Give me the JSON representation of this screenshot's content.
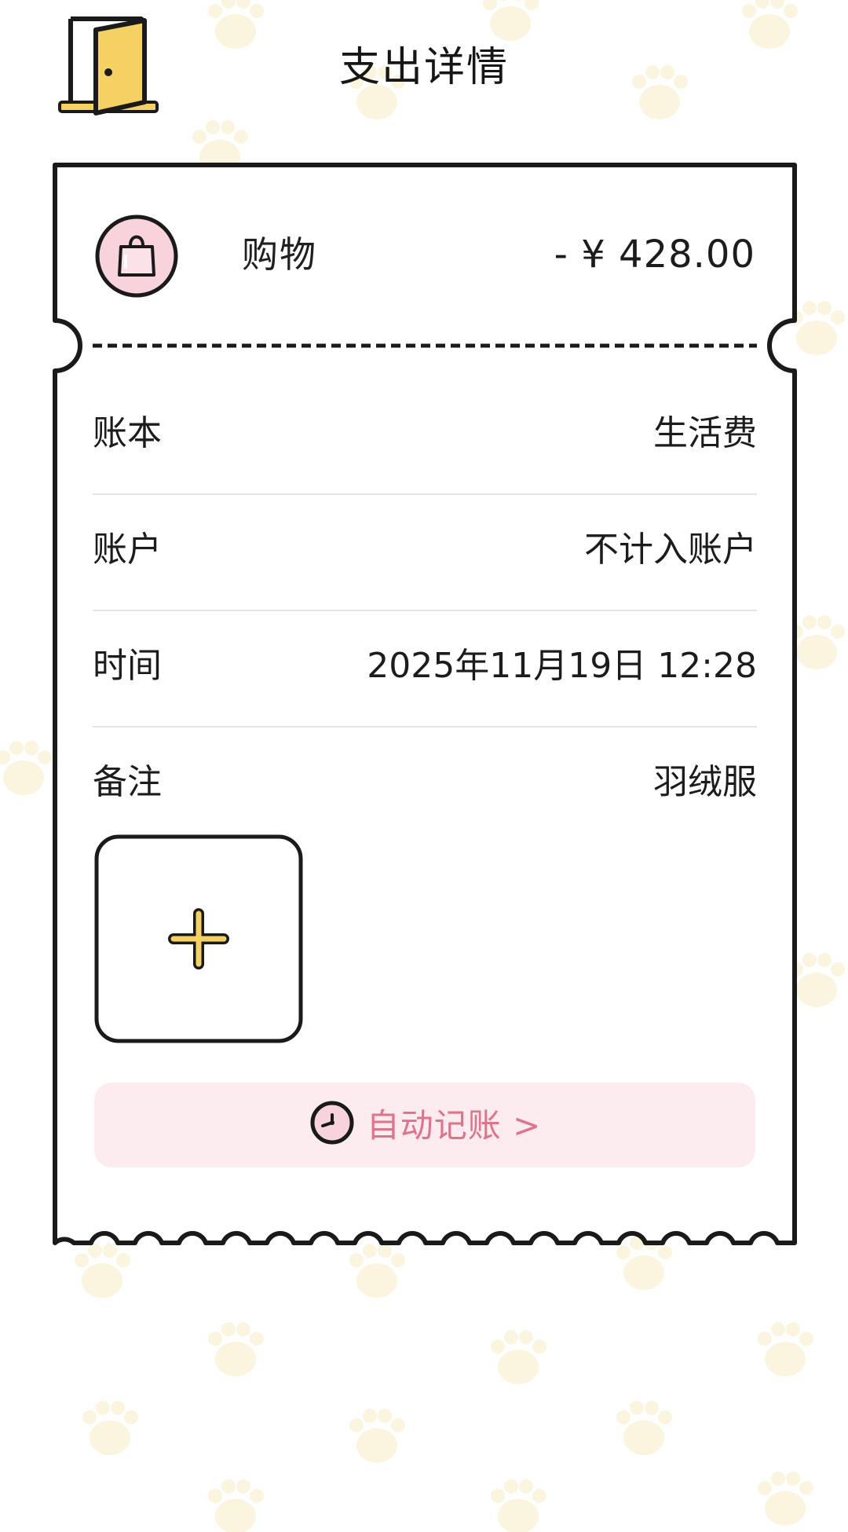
{
  "header": {
    "title": "支出详情",
    "back_icon": "door-icon"
  },
  "summary": {
    "category_icon": "shopping-bag-icon",
    "category": "购物",
    "amount": "- ¥ 428.00"
  },
  "details": [
    {
      "label": "账本",
      "value": "生活费"
    },
    {
      "label": "账户",
      "value": "不计入账户"
    },
    {
      "label": "时间",
      "value": "2025年11月19日 12:28"
    },
    {
      "label": "备注",
      "value": "羽绒服"
    }
  ],
  "attachments": {
    "add_icon": "plus-icon"
  },
  "auto_record": {
    "icon": "clock-icon",
    "label": "自动记账 >"
  },
  "colors": {
    "accent_pink": "#e0738a",
    "pink_background": "#fcecef",
    "icon_yellow": "#f4d162",
    "paw_color": "#fbf3d8",
    "outline": "#1a1a1a"
  }
}
